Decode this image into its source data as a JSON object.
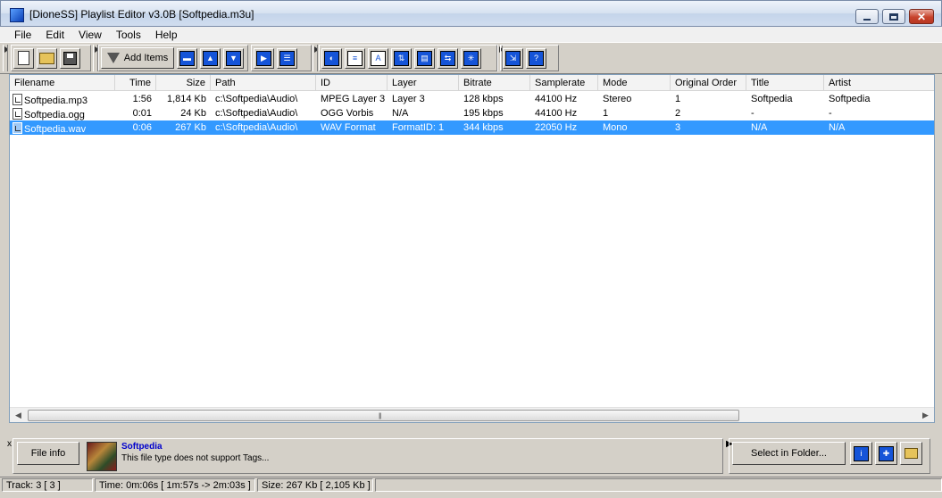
{
  "window": {
    "title": "[DioneSS] Playlist Editor v3.0B [Softpedia.m3u]"
  },
  "menu": [
    {
      "label": "File"
    },
    {
      "label": "Edit"
    },
    {
      "label": "View"
    },
    {
      "label": "Tools"
    },
    {
      "label": "Help"
    }
  ],
  "toolbar": {
    "add_items_label": "Add Items"
  },
  "list": {
    "columns": [
      "Filename",
      "Time",
      "Size",
      "Path",
      "ID",
      "Layer",
      "Bitrate",
      "Samplerate",
      "Mode",
      "Original Order",
      "Title",
      "Artist"
    ],
    "rows": [
      [
        "Softpedia.mp3",
        "1:56",
        "1,814 Kb",
        "c:\\Softpedia\\Audio\\",
        "MPEG Layer 3",
        "Layer 3",
        "128 kbps",
        "44100 Hz",
        "Stereo",
        "1",
        "Softpedia",
        "Softpedia"
      ],
      [
        "Softpedia.ogg",
        "0:01",
        "24 Kb",
        "c:\\Softpedia\\Audio\\",
        "OGG Vorbis",
        "N/A",
        "195 kbps",
        "44100 Hz",
        "1",
        "2",
        "-",
        "-"
      ],
      [
        "Softpedia.wav",
        "0:06",
        "267 Kb",
        "c:\\Softpedia\\Audio\\",
        "WAV Format",
        "FormatID: 1",
        "344 kbps",
        "22050 Hz",
        "Mono",
        "3",
        "N/A",
        "N/A"
      ]
    ],
    "selected_row": 2
  },
  "info": {
    "file_info_label": "File info",
    "title": "Softpedia",
    "message": "This file type does not support Tags...",
    "select_in_folder_label": "Select in Folder..."
  },
  "status": {
    "track": "Track: 3 [ 3 ]",
    "time": "Time: 0m:06s  [ 1m:57s -> 2m:03s ]",
    "size": "Size: 267 Kb  [ 2,105 Kb ]"
  }
}
